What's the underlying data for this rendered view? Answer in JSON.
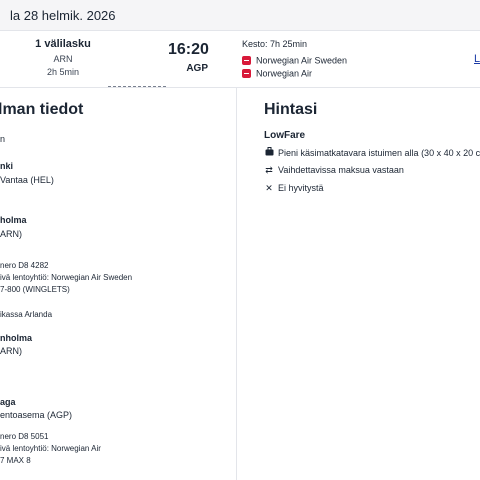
{
  "header": {
    "date": "la 28 helmik. 2026"
  },
  "summary": {
    "stops": "1 välilasku",
    "via": "ARN",
    "layover": "2h 5min",
    "arrival_time": "16:20",
    "arrival_code": "AGP",
    "duration": "Kesto: 7h 25min",
    "airlines": [
      "Norwegian Air Sweden",
      "Norwegian Air"
    ],
    "more_link": "L"
  },
  "details": {
    "title": "lman tiedot",
    "items": [
      "n",
      "nki",
      "Vantaa (HEL)",
      "holma",
      "ARN)",
      "nero D8 4282",
      "ivä lentoyhtiö: Norwegian Air Sweden",
      "7-800 (WINGLETS)",
      "ikassa Arlanda",
      "nholma",
      "ARN)",
      "aga",
      "entoasema (AGP)",
      "nero D8 5051",
      "ivä lentoyhtiö: Norwegian Air",
      "7 MAX 8"
    ]
  },
  "pricing": {
    "title": "Hintasi",
    "fare": "LowFare",
    "features": [
      {
        "icon": "bag-icon",
        "text": "Pieni käsimatkatavara istuimen alla (30 x 40 x 20 c"
      },
      {
        "icon": "exchange-icon",
        "text": "Vaihdettavissa maksua vastaan"
      },
      {
        "icon": "x-icon",
        "text": "Ei hyvitystä"
      }
    ]
  }
}
